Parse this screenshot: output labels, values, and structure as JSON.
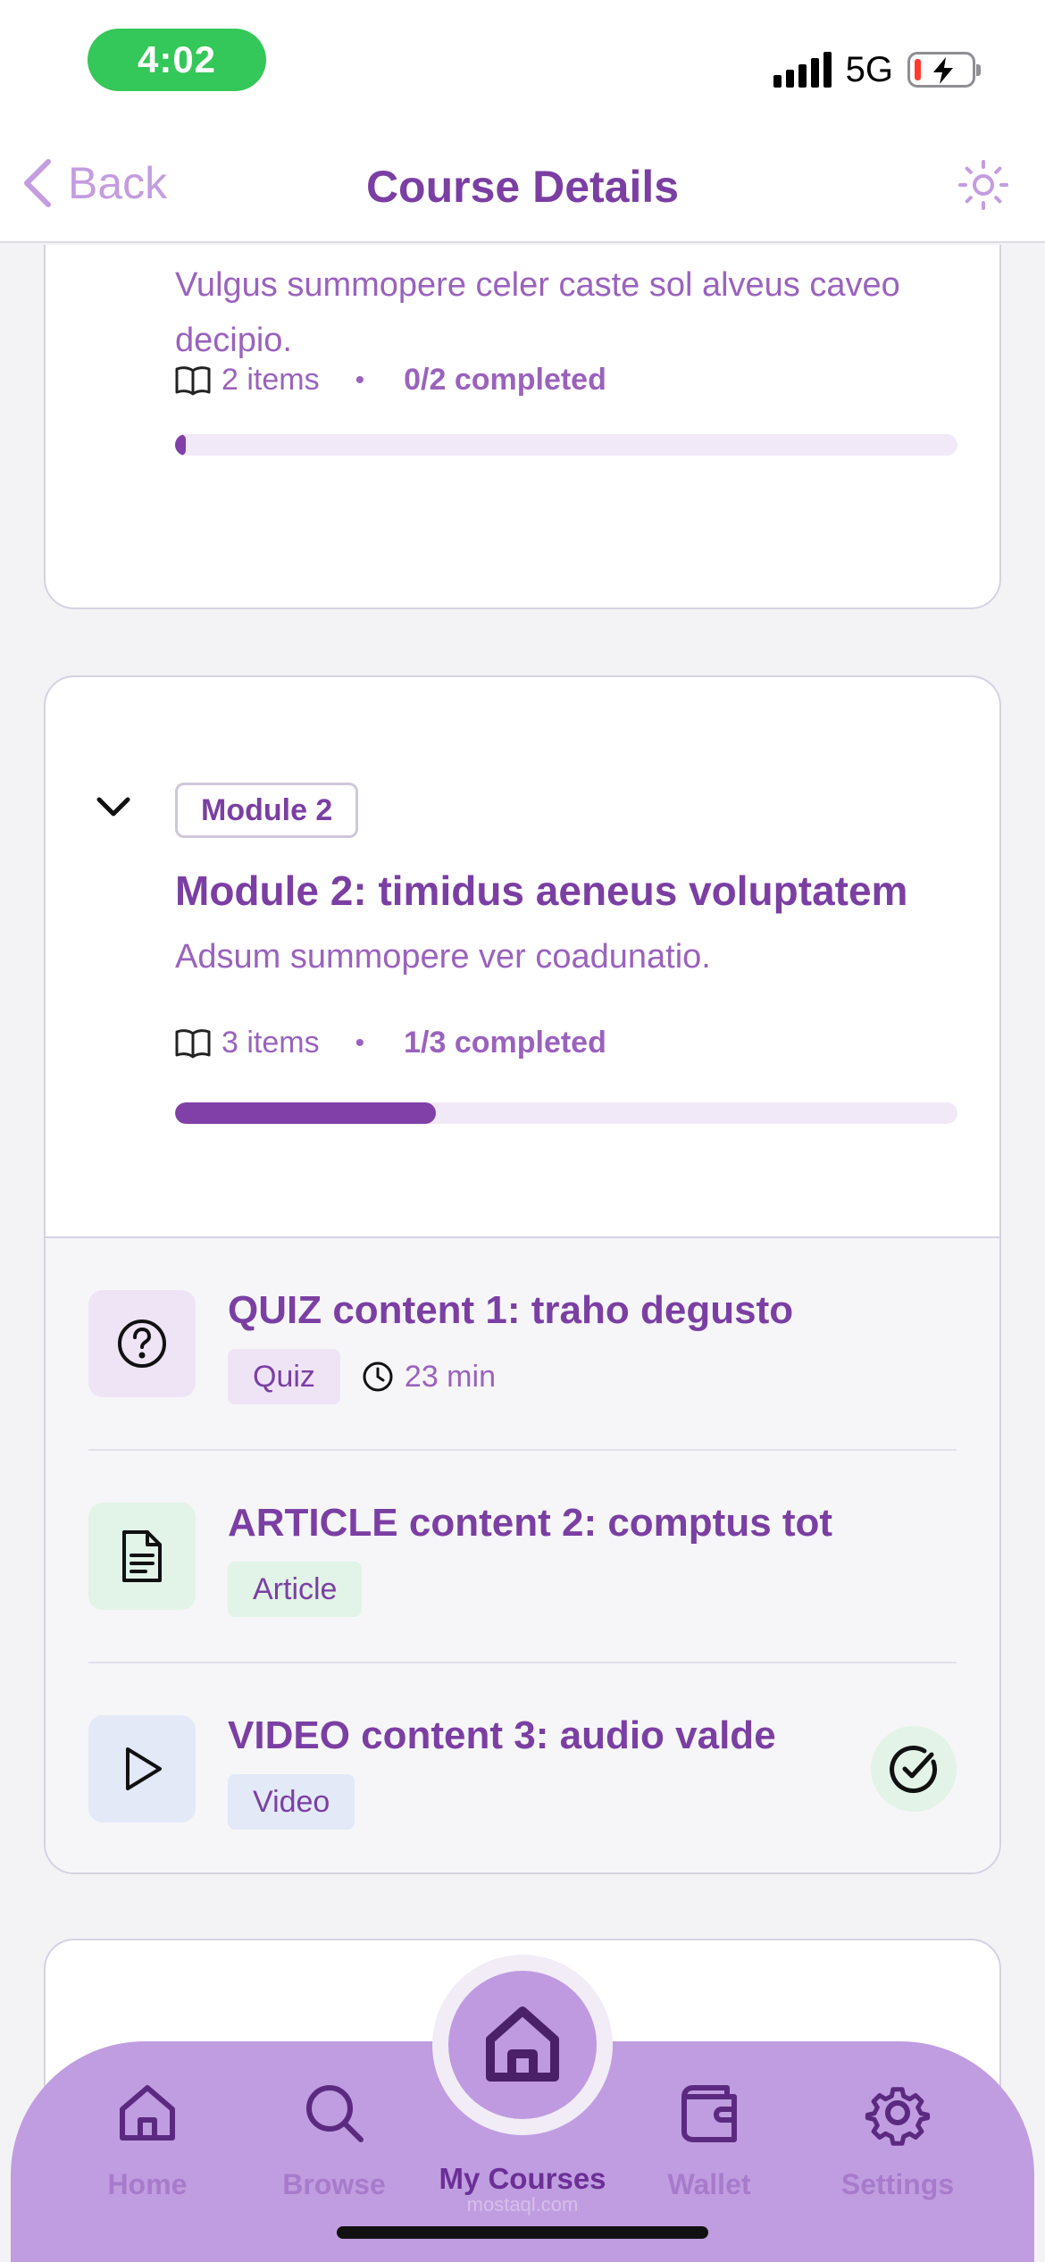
{
  "status": {
    "time": "4:02",
    "network": "5G"
  },
  "nav": {
    "back_label": "Back",
    "title": "Course Details"
  },
  "module1": {
    "description": "Vulgus summopere celer caste sol alveus caveo decipio.",
    "items_count": "2 items",
    "completed": "0/2 completed",
    "progress_fraction": 0.0
  },
  "module2": {
    "badge": "Module 2",
    "title": "Module 2: timidus aeneus voluptatem",
    "description": "Adsum summopere ver coadunatio.",
    "items_count": "3 items",
    "completed": "1/3 completed",
    "progress_fraction": 0.3333,
    "items": [
      {
        "title": "QUIZ content 1: traho degusto",
        "tag": "Quiz",
        "duration": "23 min",
        "icon": "question-circle-icon",
        "tag_color": "#efe4f6",
        "completed": false
      },
      {
        "title": "ARTICLE content 2: comptus tot",
        "tag": "Article",
        "icon": "document-icon",
        "tag_color": "#e2f3e7",
        "completed": false
      },
      {
        "title": "VIDEO content 3: audio valde",
        "tag": "Video",
        "icon": "play-icon",
        "tag_color": "#e3e9f7",
        "completed": true
      }
    ]
  },
  "tabbar": {
    "home": "Home",
    "browse": "Browse",
    "my_courses": "My Courses",
    "wallet": "Wallet",
    "settings": "Settings",
    "watermark": "mostaql.com"
  },
  "colors": {
    "accent": "#7b3fa3",
    "tabbar": "#c09de0",
    "status_green": "#34c759"
  }
}
